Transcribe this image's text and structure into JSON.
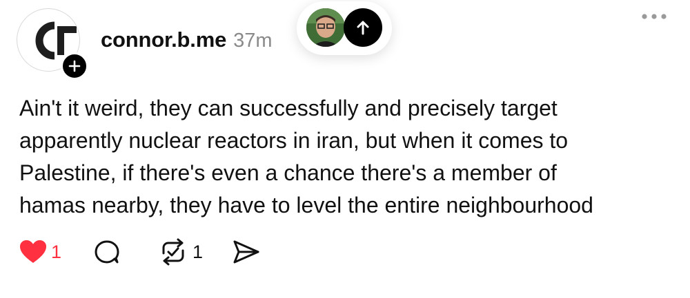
{
  "author": {
    "username": "connor.b.me",
    "time_ago": "37m",
    "avatar_initials": "CF"
  },
  "post": {
    "lines": [
      "Ain't it weird, they can successfully and precisely target",
      "apparently nuclear reactors in iran, but when it comes to",
      "Palestine, if there's even a chance there's a member of",
      "hamas nearby, they have to level the entire neighbourhood"
    ]
  },
  "actions": {
    "likes": "1",
    "reposts": "1"
  },
  "icons": {
    "follow": "plus-icon",
    "more": "more-horizontal-icon",
    "scroll_top": "arrow-up-icon",
    "like": "heart-icon",
    "reply": "comment-bubble-icon",
    "repost": "repost-icon",
    "share": "send-icon"
  },
  "colors": {
    "like_active": "#ff3040",
    "text": "#111111",
    "muted": "#8a8a8a"
  }
}
